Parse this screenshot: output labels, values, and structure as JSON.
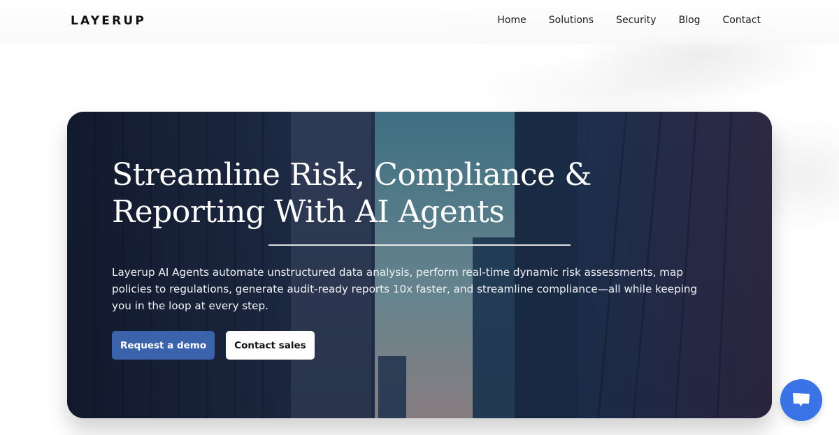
{
  "brand": {
    "logo_text": "LAYERUP"
  },
  "nav": {
    "links": [
      {
        "label": "Home"
      },
      {
        "label": "Solutions"
      },
      {
        "label": "Security"
      },
      {
        "label": "Blog"
      },
      {
        "label": "Contact"
      }
    ]
  },
  "hero": {
    "title_line1": "Streamline Risk, Compliance &",
    "title_line2": "Reporting With AI Agents",
    "description": "Layerup AI Agents automate unstructured data analysis, perform real-time dynamic risk assessments, map policies to regulations, generate audit-ready reports 10x faster, and streamline compliance—all while keeping you in the loop at every step.",
    "primary_button": "Request a demo",
    "secondary_button": "Contact sales",
    "background_image": "city-skyscrapers-photo"
  },
  "chat_widget": {
    "icon": "chat-bubble-icon"
  },
  "colors": {
    "primary_button": "#3b63ab",
    "chat_fab": "#3a73e6",
    "text_dark": "#111111"
  }
}
